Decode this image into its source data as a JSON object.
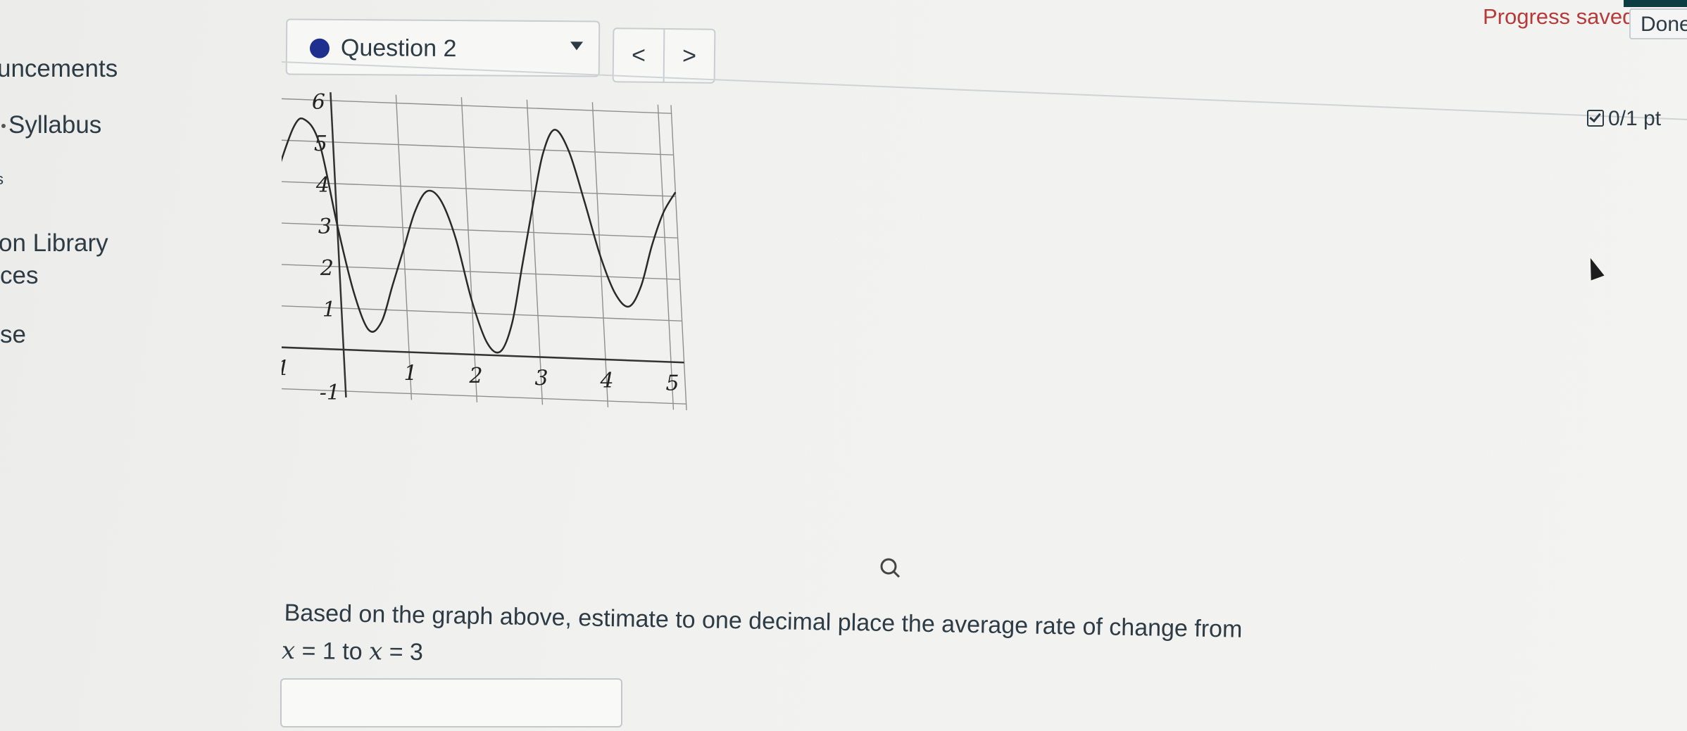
{
  "nav": {
    "items": [
      {
        "label": "uncements"
      },
      {
        "label": "Syllabus"
      },
      {
        "label": "s"
      },
      {
        "label": "on Library"
      },
      {
        "label": "ces"
      },
      {
        "label": "se"
      }
    ]
  },
  "status": {
    "progress_text": "Progress saved",
    "done_label": "Done"
  },
  "question_selector": {
    "current": "Question 2",
    "prev_label": "<",
    "next_label": ">"
  },
  "points": {
    "label": "0/1 pt"
  },
  "chart_data": {
    "type": "line",
    "title": "",
    "xlabel": "",
    "ylabel": "",
    "xlim": [
      -1,
      5.2
    ],
    "ylim": [
      -1,
      6
    ],
    "x_ticks": [
      "-1",
      "1",
      "2",
      "3",
      "4",
      "5"
    ],
    "y_ticks": [
      "-1",
      "1",
      "2",
      "3",
      "4",
      "5",
      "6"
    ],
    "grid": true,
    "series": [
      {
        "name": "",
        "x": [
          -1,
          -0.6,
          -0.4,
          -0.2,
          0,
          0.2,
          0.4,
          0.6,
          0.8,
          1.0,
          1.2,
          1.4,
          1.6,
          1.8,
          2.0,
          2.2,
          2.4,
          2.6,
          2.8,
          3.0,
          3.2,
          3.4,
          3.6,
          3.8,
          4.0,
          4.2,
          4.4,
          4.6,
          4.8,
          5.0,
          5.2
        ],
        "y": [
          3.7,
          5.3,
          5.5,
          4.9,
          3.0,
          1.4,
          0.5,
          0.7,
          1.6,
          2.5,
          3.4,
          3.9,
          3.7,
          2.8,
          1.3,
          0.3,
          0.1,
          0.8,
          2.2,
          3.6,
          4.9,
          5.5,
          5.0,
          3.8,
          2.5,
          1.6,
          1.3,
          1.8,
          2.8,
          3.6,
          4.1
        ]
      }
    ]
  },
  "question": {
    "text": "Based on the graph above, estimate to one decimal place the average rate of change from",
    "var1": "x",
    "eq1": " = 1 to ",
    "var2": "x",
    "eq2": " = 3"
  },
  "answer": {
    "value": "",
    "placeholder": ""
  }
}
